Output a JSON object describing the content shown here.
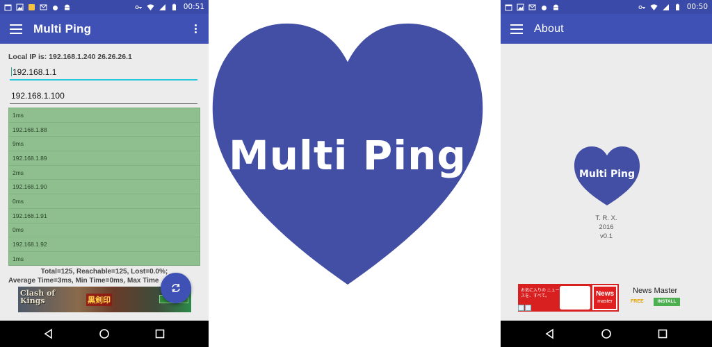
{
  "left_phone": {
    "status_bar": {
      "time": "00:51",
      "left_icons": [
        "calendar-icon",
        "image-icon",
        "alert-icon",
        "mail-icon",
        "drop-icon",
        "android-icon"
      ],
      "right_icons": [
        "key-icon",
        "wifi-icon",
        "signal-icon",
        "battery-icon"
      ]
    },
    "app_bar": {
      "title": "Multi Ping",
      "menu_icon": "hamburger-menu-icon",
      "overflow_icon": "more-vert-icon"
    },
    "local_ip": "Local IP is: 192.168.1.240 26.26.26.1",
    "start_ip_value": "192.168.1.1",
    "end_ip_value": "192.168.1.100",
    "results": [
      "1ms",
      "192.168.1.88",
      "9ms",
      "192.168.1.89",
      "2ms",
      "192.168.1.90",
      "0ms",
      "192.168.1.91",
      "0ms",
      "192.168.1.92",
      "1ms"
    ],
    "summary_line1": "Total=125, Reachable=125, Lost=0.0%;",
    "summary_line2": "Average Time=3ms, Min Time=0ms, Max Time",
    "ad": {
      "text1": "Clash of",
      "text1b": "Kings",
      "text2": "黒剣印"
    },
    "fab_icon": "refresh-icon",
    "nav": [
      "back-icon",
      "home-icon",
      "recents-icon"
    ]
  },
  "center": {
    "logo_text": "Multi Ping",
    "accent": "#434fa4"
  },
  "right_phone": {
    "status_bar": {
      "time": "00:50",
      "left_icons": [
        "calendar-icon",
        "image-icon",
        "mail-icon",
        "drop-icon",
        "android-icon"
      ],
      "right_icons": [
        "key-icon",
        "wifi-icon",
        "signal-icon",
        "battery-icon"
      ]
    },
    "app_bar": {
      "title": "About",
      "menu_icon": "hamburger-menu-icon"
    },
    "logo_text": "Multi Ping",
    "author": "T. R. X.",
    "year": "2016",
    "version": "v0.1",
    "ad": {
      "jp_text": "お気に入りの ニュースを、すべて。",
      "logo_line1": "News",
      "logo_line2": "master",
      "title": "News Master",
      "free": "FREE",
      "install": "INSTALL"
    },
    "nav": [
      "back-icon",
      "home-icon",
      "recents-icon"
    ]
  },
  "colors": {
    "primary": "#3f51b5",
    "primary_dark": "#3a4aa8",
    "result_bg": "#8fbf8e",
    "input_focus": "#26c6da"
  }
}
